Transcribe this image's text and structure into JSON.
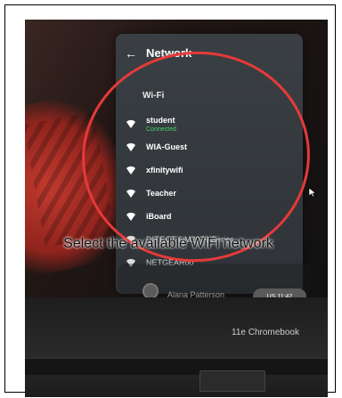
{
  "header": {
    "title": "Network"
  },
  "wifi": {
    "section_title": "Wi-Fi",
    "networks": [
      {
        "name": "student",
        "status": "Connected"
      },
      {
        "name": "WIA-Guest"
      },
      {
        "name": "xfinitywifi"
      },
      {
        "name": "Teacher"
      },
      {
        "name": "iBoard"
      },
      {
        "name": "DIRECT-6iM2070 Series"
      },
      {
        "name": "NETGEAR00"
      }
    ]
  },
  "caption": "Select the available WiFi network",
  "login": {
    "user_name": "Alana Patterson",
    "status_time": "US 11:42"
  },
  "laptop": {
    "brand": "11e Chromebook"
  },
  "colors": {
    "accent_red": "#e53a3a",
    "connected_green": "#45d36a"
  }
}
